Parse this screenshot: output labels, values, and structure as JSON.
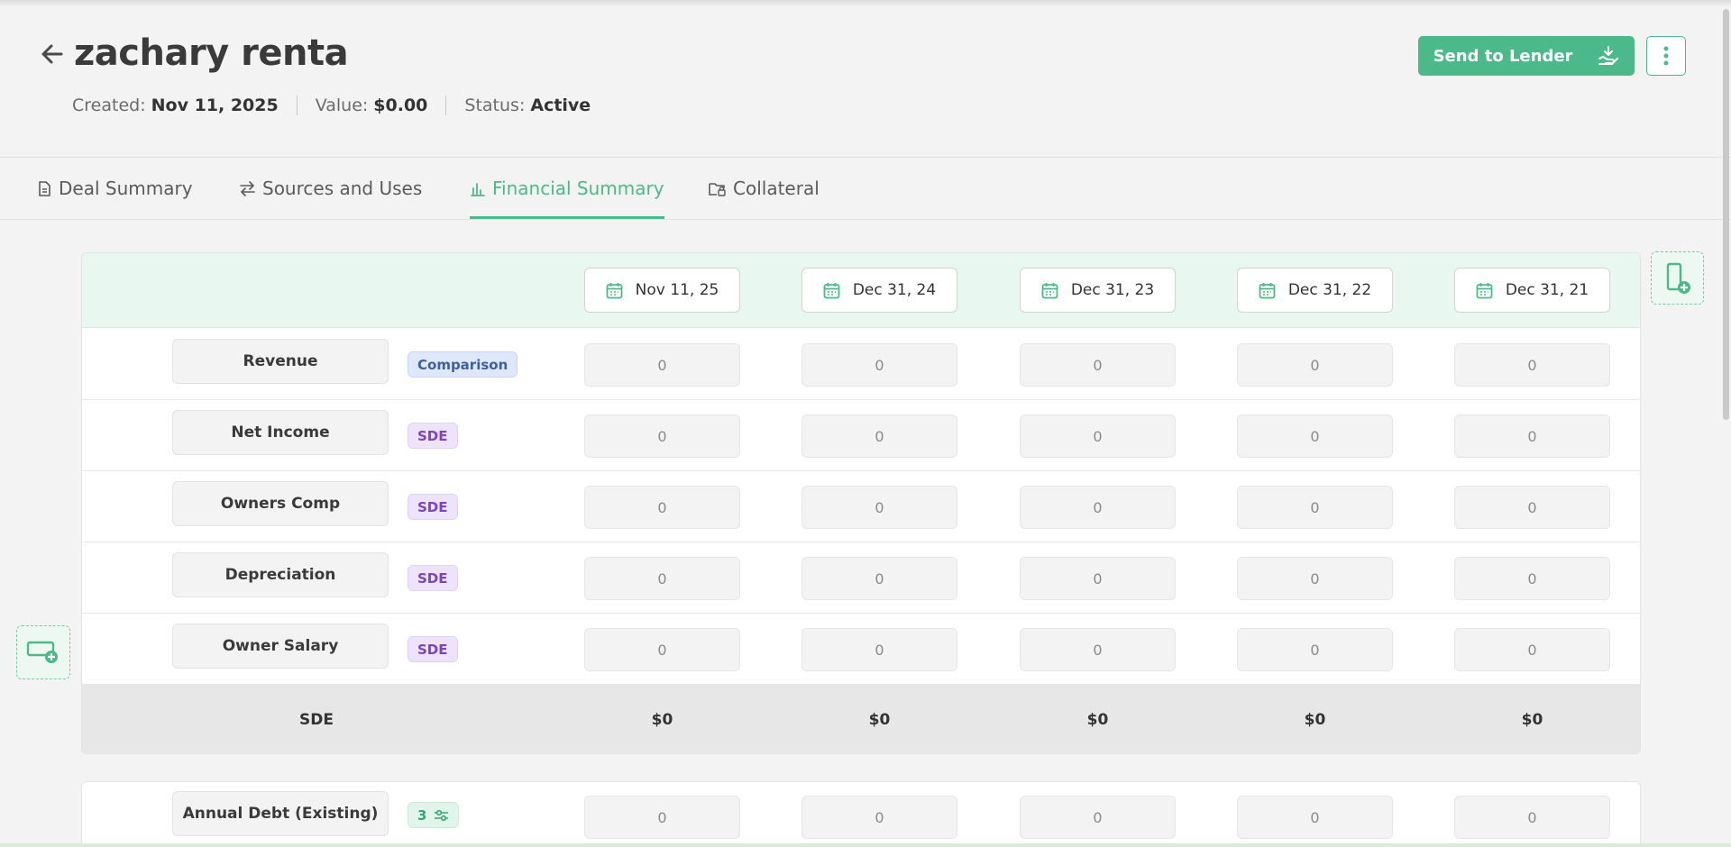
{
  "header": {
    "title": "zachary renta",
    "created_label": "Created:",
    "created_value": "Nov 11, 2025",
    "value_label": "Value:",
    "value_value": "$0.00",
    "status_label": "Status:",
    "status_value": "Active",
    "send_label": "Send to Lender"
  },
  "tabs": [
    {
      "label": "Deal Summary",
      "icon": "document-icon"
    },
    {
      "label": "Sources and Uses",
      "icon": "swap-arrows-icon"
    },
    {
      "label": "Financial Summary",
      "icon": "bar-chart-icon",
      "active": true
    },
    {
      "label": "Collateral",
      "icon": "folder-lock-icon"
    }
  ],
  "table": {
    "dates": [
      "Nov 11, 25",
      "Dec 31, 24",
      "Dec 31, 23",
      "Dec 31, 22",
      "Dec 31, 21"
    ],
    "rows": [
      {
        "label": "Revenue",
        "badge": "Comparison",
        "values": [
          "0",
          "0",
          "0",
          "0",
          "0"
        ]
      },
      {
        "label": "Net Income",
        "badge": "SDE",
        "values": [
          "0",
          "0",
          "0",
          "0",
          "0"
        ]
      },
      {
        "label": "Owners Comp",
        "badge": "SDE",
        "values": [
          "0",
          "0",
          "0",
          "0",
          "0"
        ]
      },
      {
        "label": "Depreciation",
        "badge": "SDE",
        "values": [
          "0",
          "0",
          "0",
          "0",
          "0"
        ]
      },
      {
        "label": "Owner Salary",
        "badge": "SDE",
        "values": [
          "0",
          "0",
          "0",
          "0",
          "0"
        ]
      }
    ],
    "total": {
      "label": "SDE",
      "values": [
        "$0",
        "$0",
        "$0",
        "$0",
        "$0"
      ]
    }
  },
  "debt": {
    "label": "Annual Debt (Existing)",
    "badge_count": "3",
    "values": [
      "0",
      "0",
      "0",
      "0",
      "0"
    ]
  },
  "colors": {
    "accent": "#4cb98a",
    "comparison": "#3f5f9e",
    "sde": "#7c44c0"
  }
}
